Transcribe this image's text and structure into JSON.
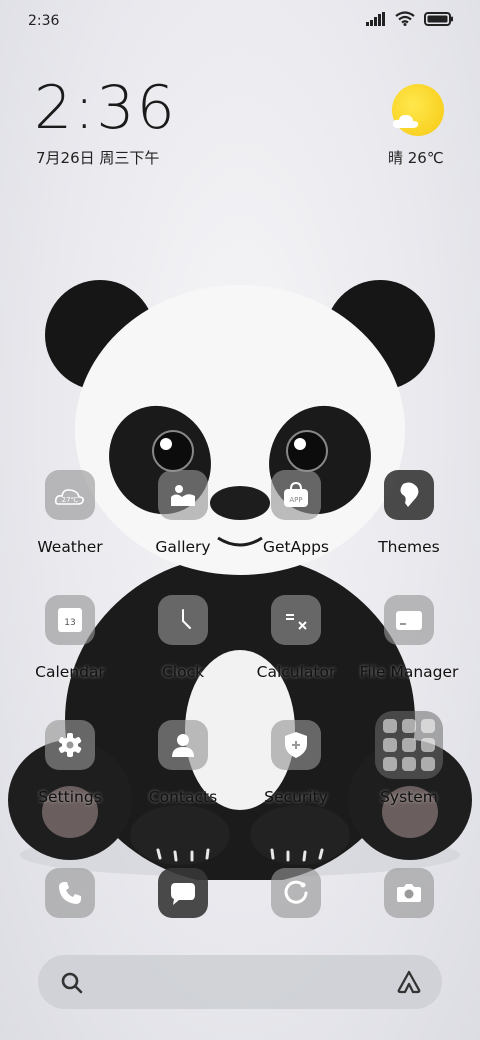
{
  "status_bar": {
    "time": "2:36"
  },
  "widget": {
    "time": "2:36",
    "date": "7月26日 周三下午",
    "weather": "晴 26℃",
    "weather_icon": "sun-cloud-icon"
  },
  "apps": [
    {
      "label": "Weather",
      "icon": "weather-icon",
      "icon_text": "27℃"
    },
    {
      "label": "Gallery",
      "icon": "gallery-icon"
    },
    {
      "label": "GetApps",
      "icon": "getapps-icon",
      "icon_text": "APP"
    },
    {
      "label": "Themes",
      "icon": "themes-icon"
    },
    {
      "label": "Calendar",
      "icon": "calendar-icon",
      "icon_text": "13"
    },
    {
      "label": "Clock",
      "icon": "clock-icon"
    },
    {
      "label": "Calculator",
      "icon": "calculator-icon"
    },
    {
      "label": "File Manager",
      "icon": "file-manager-icon"
    },
    {
      "label": "Settings",
      "icon": "settings-icon"
    },
    {
      "label": "Contacts",
      "icon": "contacts-icon"
    },
    {
      "label": "Security",
      "icon": "security-icon"
    },
    {
      "label": "System",
      "icon": "system-folder-icon"
    }
  ],
  "dock": [
    {
      "name": "phone",
      "icon": "phone-icon"
    },
    {
      "name": "messages",
      "icon": "message-icon"
    },
    {
      "name": "browser",
      "icon": "browser-icon"
    },
    {
      "name": "camera",
      "icon": "camera-icon"
    }
  ],
  "search": {
    "icon": "search-icon",
    "assistant_icon": "assistant-icon"
  },
  "colors": {
    "weather_sun": "#f6c812",
    "tile_gray": "#969696",
    "tile_dark": "#373737"
  }
}
